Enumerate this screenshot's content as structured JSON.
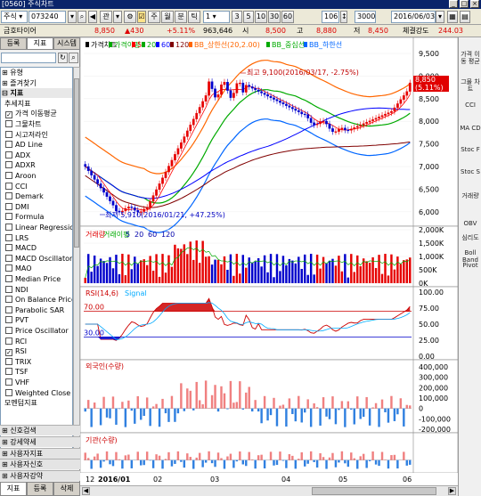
{
  "window": {
    "title": "[0560] 주식차트"
  },
  "toolbar": {
    "market": "주식",
    "code": "073240",
    "period_buttons": [
      "관",
      "주",
      "월",
      "분",
      "틱",
      "1",
      "3",
      "5",
      "10",
      "30",
      "60"
    ],
    "bar_count": "106",
    "total_count": "3000",
    "date": "2016/06/03"
  },
  "pricebar": {
    "name": "금호타이어",
    "price": "8,850",
    "change": "▲430",
    "rate": "+5.11%",
    "volume": "963,646",
    "open_label": "시",
    "open": "8,500",
    "high_label": "고",
    "high": "8,880",
    "low_label": "저",
    "low": "8,450",
    "strength_label": "체결강도",
    "strength": "244.03"
  },
  "left": {
    "tabs": [
      "등록",
      "지표",
      "시스템"
    ],
    "list": [
      {
        "label": "유형",
        "type": "top"
      },
      {
        "label": "즐겨찾기",
        "type": "top"
      },
      {
        "label": "지표",
        "type": "group"
      },
      {
        "label": "추세지표",
        "type": "sub"
      },
      {
        "label": "가격 이동평균",
        "checked": true
      },
      {
        "label": "그물차트",
        "checked": false
      },
      {
        "label": "시고저라인",
        "checked": false
      },
      {
        "label": "AD Line",
        "checked": false
      },
      {
        "label": "ADX",
        "checked": false
      },
      {
        "label": "ADXR",
        "checked": false
      },
      {
        "label": "Aroon",
        "checked": false
      },
      {
        "label": "CCI",
        "checked": false
      },
      {
        "label": "Demark",
        "checked": false
      },
      {
        "label": "DMI",
        "checked": false
      },
      {
        "label": "Formula",
        "checked": false
      },
      {
        "label": "Linear Regression",
        "checked": false
      },
      {
        "label": "LRS",
        "checked": false
      },
      {
        "label": "MACD",
        "checked": false
      },
      {
        "label": "MACD Oscillator",
        "checked": false
      },
      {
        "label": "MAO",
        "checked": false
      },
      {
        "label": "Median Price",
        "checked": false
      },
      {
        "label": "NDI",
        "checked": false
      },
      {
        "label": "On Balance Price",
        "checked": false
      },
      {
        "label": "Parabolic SAR",
        "checked": false
      },
      {
        "label": "PVT",
        "checked": false
      },
      {
        "label": "Price Oscillator",
        "checked": false
      },
      {
        "label": "RCI",
        "checked": false
      },
      {
        "label": "RSI",
        "checked": true
      },
      {
        "label": "TRIX",
        "checked": false
      },
      {
        "label": "TSF",
        "checked": false
      },
      {
        "label": "VHF",
        "checked": false
      },
      {
        "label": "Weighted Close",
        "checked": false
      },
      {
        "label": "모멘텀지표",
        "type": "sub"
      }
    ],
    "sections": [
      "신호검색",
      "강세약세",
      "사용자지표",
      "사용자신호",
      "사용자강약"
    ],
    "bottom_tabs": [
      "지표",
      "등록",
      "삭제"
    ]
  },
  "right_toolbar": [
    "가격 이동 평균",
    "그물 차트",
    "CCI",
    "MA CD",
    "Stoc F",
    "Stoc S",
    "거래량",
    "OBV",
    "심리도",
    "Boll Band",
    "Pivot"
  ],
  "panes": {
    "price": {
      "legend": [
        "가격차트",
        "가격이평",
        "5",
        "20",
        "60",
        "120",
        "BB_상한선(20,2.00)",
        "BB_중심선",
        "BB_하한선"
      ],
      "annotations": {
        "high": "최고 9,100(2016/03/17, -2.75%)",
        "low": "최저 5,910(2016/01/21, +47.25%)",
        "current": "8,850",
        "current_rate": "(5.11%)"
      },
      "y_ticks": [
        "9,500",
        "9,000",
        "8,500",
        "8,000",
        "7,500",
        "7,000",
        "6,500",
        "6,000"
      ]
    },
    "volume": {
      "legend": [
        "거래량",
        "거래이평",
        "5",
        "20",
        "60",
        "120"
      ],
      "y_ticks": [
        "2,000K",
        "1,500K",
        "1,000K",
        "500K",
        "0K"
      ]
    },
    "rsi": {
      "legend": [
        "RSI(14,6)",
        "Signal"
      ],
      "levels": [
        "70.00",
        "30.00"
      ],
      "y_ticks": [
        "100.00",
        "75.00",
        "50.00",
        "25.00",
        "0.00"
      ]
    },
    "foreign": {
      "legend": [
        "외국인(수량)"
      ],
      "y_ticks": [
        "400,000",
        "300,000",
        "200,000",
        "100,000",
        "0",
        "-100,000",
        "-200,000"
      ]
    },
    "institution": {
      "legend": [
        "기관(수량)"
      ],
      "y_ticks": [
        "200,000",
        "100,000",
        "0",
        "-100,000"
      ]
    }
  },
  "x_axis": [
    "12",
    "2016/01",
    "02",
    "03",
    "04",
    "05",
    "06"
  ],
  "colors": {
    "up": "#e60000",
    "down": "#0000cc",
    "ma5": "#ff0000",
    "ma20": "#009900",
    "ma60": "#0000ff",
    "ma120": "#800000",
    "bb_upper": "#ff6600",
    "bb_mid": "#00aa00",
    "bb_lower": "#0066ff"
  },
  "chart_data": {
    "type": "candlestick",
    "x": [
      "12",
      "2016/01",
      "02",
      "03",
      "04",
      "05",
      "06"
    ],
    "price_ylim": [
      5800,
      9500
    ],
    "price_high": 9100,
    "price_low": 5910,
    "volume_ylim": [
      0,
      2000
    ],
    "rsi_ylim": [
      0,
      100
    ],
    "foreign_ylim": [
      -200000,
      400000
    ],
    "institution_ylim": [
      -100000,
      200000
    ]
  }
}
